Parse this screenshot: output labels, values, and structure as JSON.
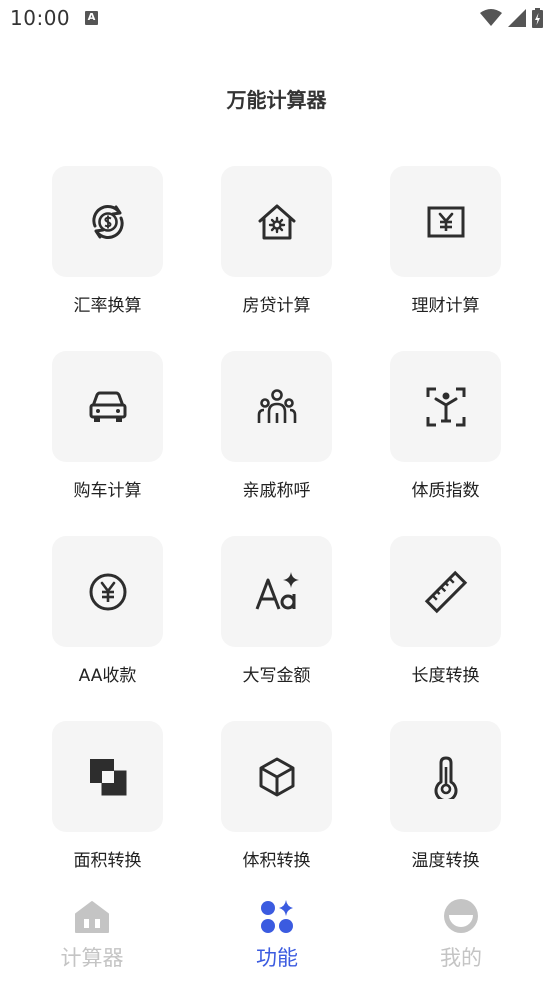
{
  "status_bar": {
    "time": "10:00",
    "notification_letter": "A"
  },
  "page": {
    "title": "万能计算器"
  },
  "features": [
    {
      "label": "汇率换算",
      "icon": "currency-exchange-icon"
    },
    {
      "label": "房贷计算",
      "icon": "house-loan-icon"
    },
    {
      "label": "理财计算",
      "icon": "finance-icon"
    },
    {
      "label": "购车计算",
      "icon": "car-icon"
    },
    {
      "label": "亲戚称呼",
      "icon": "family-icon"
    },
    {
      "label": "体质指数",
      "icon": "body-scan-icon"
    },
    {
      "label": "AA收款",
      "icon": "yen-coin-icon"
    },
    {
      "label": "大写金额",
      "icon": "font-case-icon"
    },
    {
      "label": "长度转换",
      "icon": "ruler-icon"
    },
    {
      "label": "面积转换",
      "icon": "area-squares-icon"
    },
    {
      "label": "体积转换",
      "icon": "cube-icon"
    },
    {
      "label": "温度转换",
      "icon": "thermometer-icon"
    }
  ],
  "bottom_nav": [
    {
      "label": "计算器",
      "icon": "home-icon",
      "active": false
    },
    {
      "label": "功能",
      "icon": "apps-icon",
      "active": true
    },
    {
      "label": "我的",
      "icon": "profile-icon",
      "active": false
    }
  ],
  "colors": {
    "active": "#3b5be0",
    "inactive": "#c4c4c4",
    "tile_bg": "#f5f5f5",
    "icon": "#2d2d2d"
  }
}
